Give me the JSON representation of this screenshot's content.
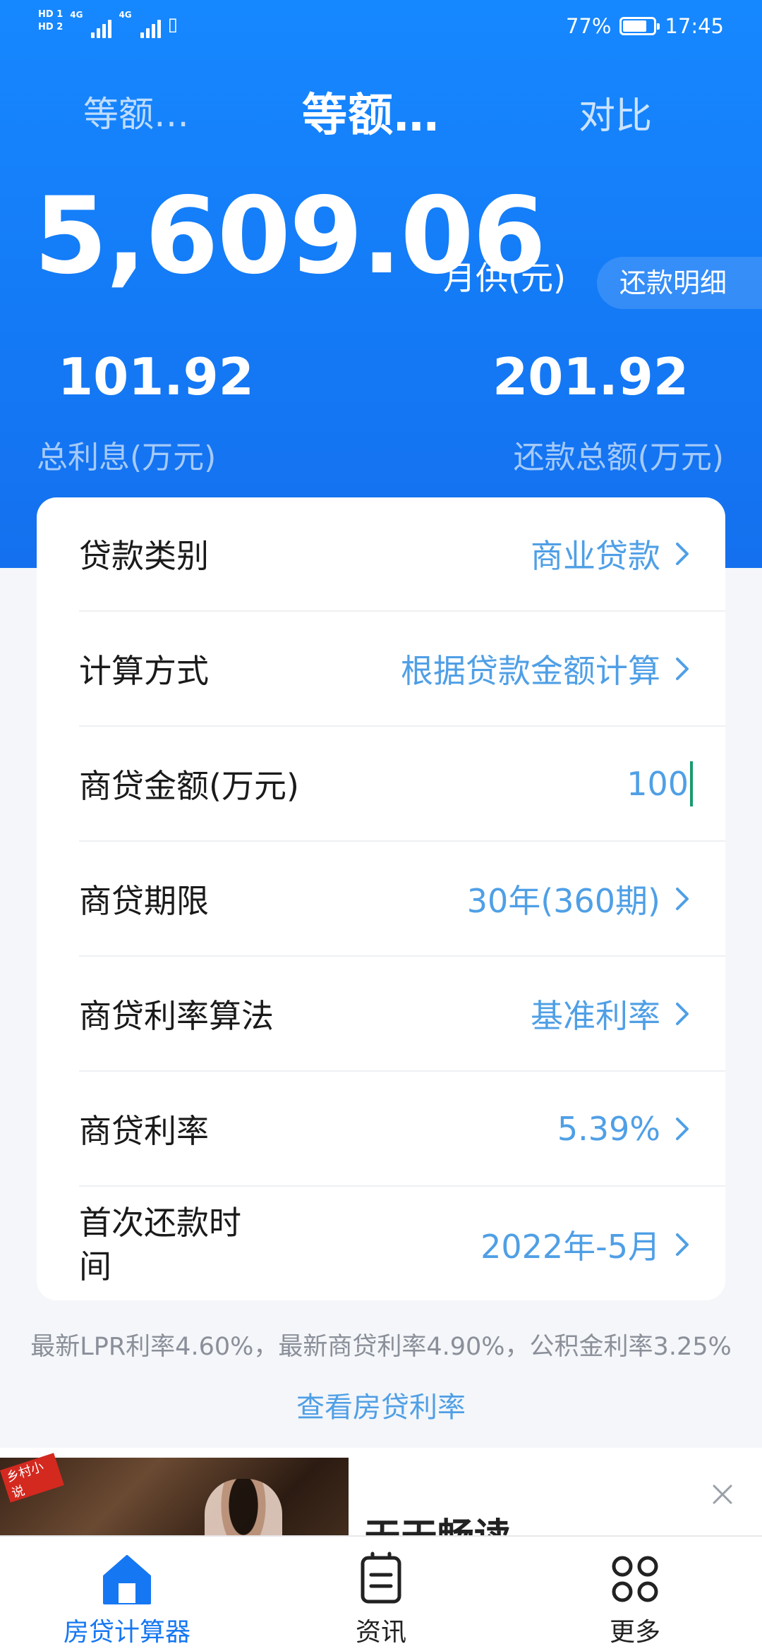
{
  "status_bar": {
    "sim1": "HD 1",
    "sim2": "HD 2",
    "network": "4G",
    "battery": "77%",
    "battery_level": 0.77,
    "time": "17:45"
  },
  "tabs": [
    {
      "label": "等额…"
    },
    {
      "label": "等额…",
      "active": true
    },
    {
      "label": "对比"
    }
  ],
  "summary": {
    "monthly_payment": "5,609.06",
    "monthly_unit": "月供(元)",
    "detail_button": "还款明细",
    "total_interest": "101.92",
    "total_interest_label": "总利息(万元)",
    "total_repayment": "201.92",
    "total_repayment_label": "还款总额(万元)"
  },
  "form": {
    "loan_type": {
      "label": "贷款类别",
      "value": "商业贷款"
    },
    "calc_method": {
      "label": "计算方式",
      "value": "根据贷款金额计算"
    },
    "loan_amount": {
      "label": "商贷金额(万元)",
      "value": "100"
    },
    "loan_term": {
      "label": "商贷期限",
      "value": "30年(360期)"
    },
    "rate_method": {
      "label": "商贷利率算法",
      "value": "基准利率"
    },
    "rate": {
      "label": "商贷利率",
      "value": "5.39%"
    },
    "first_payment": {
      "label": "首次还款时间",
      "value": "2022年-5月"
    }
  },
  "rates_info": "最新LPR利率4.60%，最新商贷利率4.90%，公积金利率3.25%",
  "rates_link": "查看房贷利率",
  "ad": {
    "badge": "乡村小说",
    "title": "天天畅读"
  },
  "bottom_nav": [
    {
      "label": "房贷计算器",
      "icon": "house-icon",
      "active": true
    },
    {
      "label": "资讯",
      "icon": "document-icon"
    },
    {
      "label": "更多",
      "icon": "grid-icon"
    }
  ],
  "colors": {
    "header_blue": "#1479f5",
    "value_blue": "#4f9fe6",
    "active_nav": "#1677f2"
  }
}
